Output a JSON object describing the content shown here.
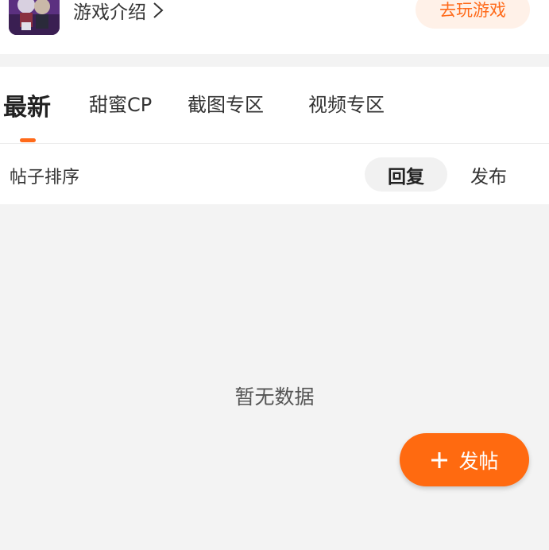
{
  "header": {
    "intro_label": "游戏介绍",
    "play_label": "去玩游戏",
    "game_icon": "game-avatar-icon"
  },
  "tabs": [
    {
      "label": "最新",
      "active": true
    },
    {
      "label": "甜蜜CP",
      "active": false
    },
    {
      "label": "截图专区",
      "active": false
    },
    {
      "label": "视频专区",
      "active": false
    }
  ],
  "sort": {
    "title": "帖子排序",
    "options": [
      {
        "label": "回复",
        "active": true
      },
      {
        "label": "发布",
        "active": false
      }
    ]
  },
  "empty_text": "暂无数据",
  "fab": {
    "label": "发帖",
    "icon": "plus-icon"
  },
  "colors": {
    "accent": "#ff6a1a",
    "accent_bg": "#fff1e8",
    "page_bg": "#f3f3f3"
  }
}
